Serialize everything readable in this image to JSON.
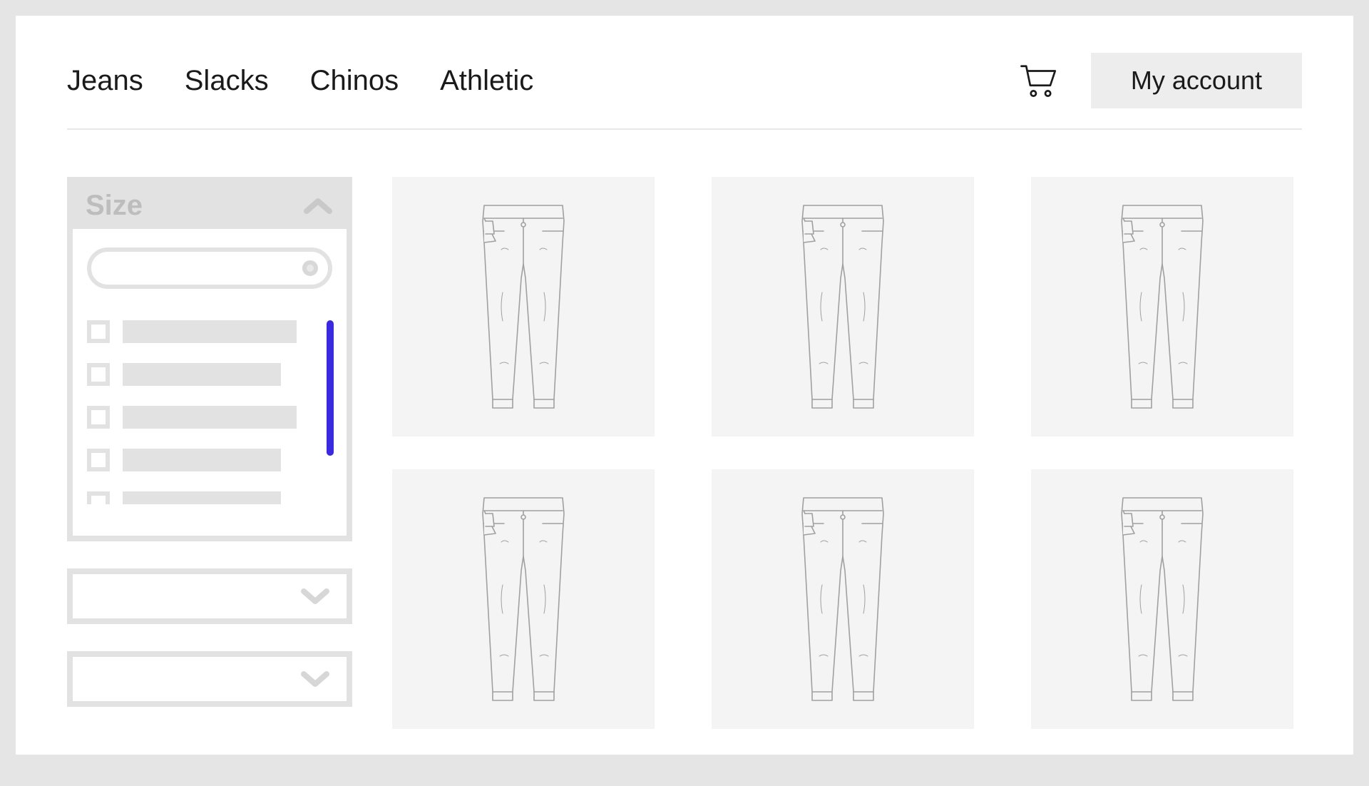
{
  "nav": {
    "items": [
      "Jeans",
      "Slacks",
      "Chinos",
      "Athletic"
    ]
  },
  "header": {
    "account_label": "My account"
  },
  "sidebar": {
    "size_filter": {
      "title": "Size",
      "option_widths": [
        244,
        222,
        244,
        222,
        222
      ]
    }
  },
  "colors": {
    "scroll_thumb": "#3a2adf"
  },
  "products": {
    "count": 6
  }
}
